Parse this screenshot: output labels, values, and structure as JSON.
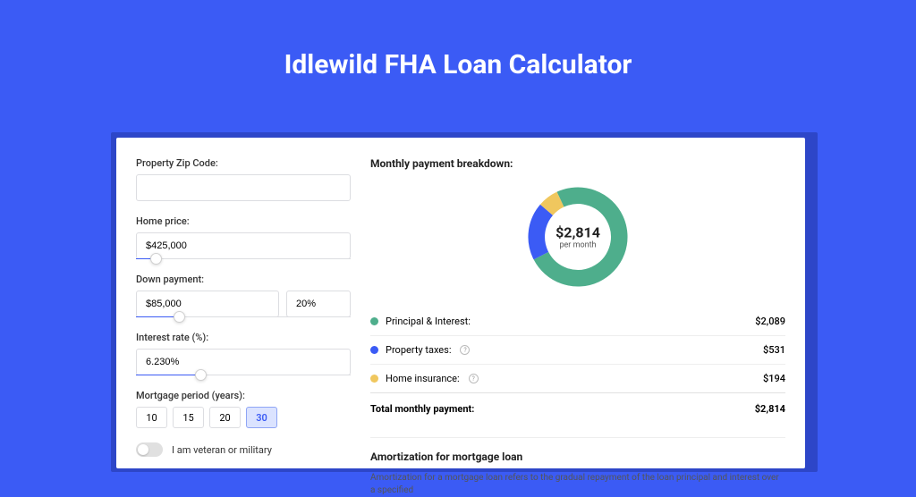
{
  "title": "Idlewild FHA Loan Calculator",
  "form": {
    "zip_label": "Property Zip Code:",
    "zip_value": "",
    "home_price_label": "Home price:",
    "home_price_value": "$425,000",
    "home_price_slider_pct": 9,
    "down_payment_label": "Down payment:",
    "down_payment_value": "$85,000",
    "down_payment_pct_value": "20%",
    "down_payment_slider_pct": 20,
    "interest_label": "Interest rate (%):",
    "interest_value": "6.230%",
    "interest_slider_pct": 30,
    "period_label": "Mortgage period (years):",
    "periods": [
      "10",
      "15",
      "20",
      "30"
    ],
    "period_selected": "30",
    "veteran_label": "I am veteran or military",
    "veteran_on": false
  },
  "breakdown": {
    "title": "Monthly payment breakdown:",
    "center_amount": "$2,814",
    "center_sub": "per month",
    "items": [
      {
        "label": "Principal & Interest:",
        "value": "$2,089",
        "color": "#4eae8c",
        "info": false
      },
      {
        "label": "Property taxes:",
        "value": "$531",
        "color": "#3b5bf5",
        "info": true
      },
      {
        "label": "Home insurance:",
        "value": "$194",
        "color": "#f0c75e",
        "info": true
      }
    ],
    "total_label": "Total monthly payment:",
    "total_value": "$2,814"
  },
  "chart_data": {
    "type": "pie",
    "title": "Monthly payment breakdown",
    "series": [
      {
        "name": "Principal & Interest",
        "value": 2089,
        "color": "#4eae8c"
      },
      {
        "name": "Property taxes",
        "value": 531,
        "color": "#3b5bf5"
      },
      {
        "name": "Home insurance",
        "value": 194,
        "color": "#f0c75e"
      }
    ],
    "total": 2814,
    "center_label": "$2,814 per month"
  },
  "amort": {
    "title": "Amortization for mortgage loan",
    "text": "Amortization for a mortgage loan refers to the gradual repayment of the loan principal and interest over a specified"
  }
}
